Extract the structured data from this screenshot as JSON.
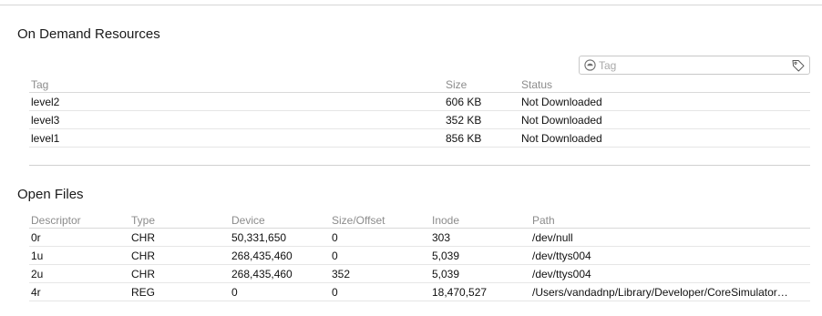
{
  "on_demand_resources": {
    "title": "On Demand Resources",
    "search": {
      "placeholder": "Tag",
      "value": ""
    },
    "columns": {
      "tag": "Tag",
      "size": "Size",
      "status": "Status"
    },
    "rows": [
      {
        "tag": "level2",
        "size": "606 KB",
        "status": "Not Downloaded"
      },
      {
        "tag": "level3",
        "size": "352 KB",
        "status": "Not Downloaded"
      },
      {
        "tag": "level1",
        "size": "856 KB",
        "status": "Not Downloaded"
      }
    ]
  },
  "open_files": {
    "title": "Open Files",
    "columns": {
      "descriptor": "Descriptor",
      "type": "Type",
      "device": "Device",
      "size_offset": "Size/Offset",
      "inode": "Inode",
      "path": "Path"
    },
    "rows": [
      {
        "descriptor": "0r",
        "type": "CHR",
        "device": "50,331,650",
        "size_offset": "0",
        "inode": "303",
        "path": "/dev/null"
      },
      {
        "descriptor": "1u",
        "type": "CHR",
        "device": "268,435,460",
        "size_offset": "0",
        "inode": "5,039",
        "path": "/dev/ttys004"
      },
      {
        "descriptor": "2u",
        "type": "CHR",
        "device": "268,435,460",
        "size_offset": "352",
        "inode": "5,039",
        "path": "/dev/ttys004"
      },
      {
        "descriptor": "4r",
        "type": "REG",
        "device": "0",
        "size_offset": "0",
        "inode": "18,470,527",
        "path": "/Users/vandadnp/Library/Developer/CoreSimulator…"
      }
    ]
  },
  "icons": {
    "filter": "filter-circle-icon",
    "tag": "tag-icon"
  },
  "colors": {
    "header_text": "#8c8c8c",
    "row_separator": "#e6e6e6"
  }
}
